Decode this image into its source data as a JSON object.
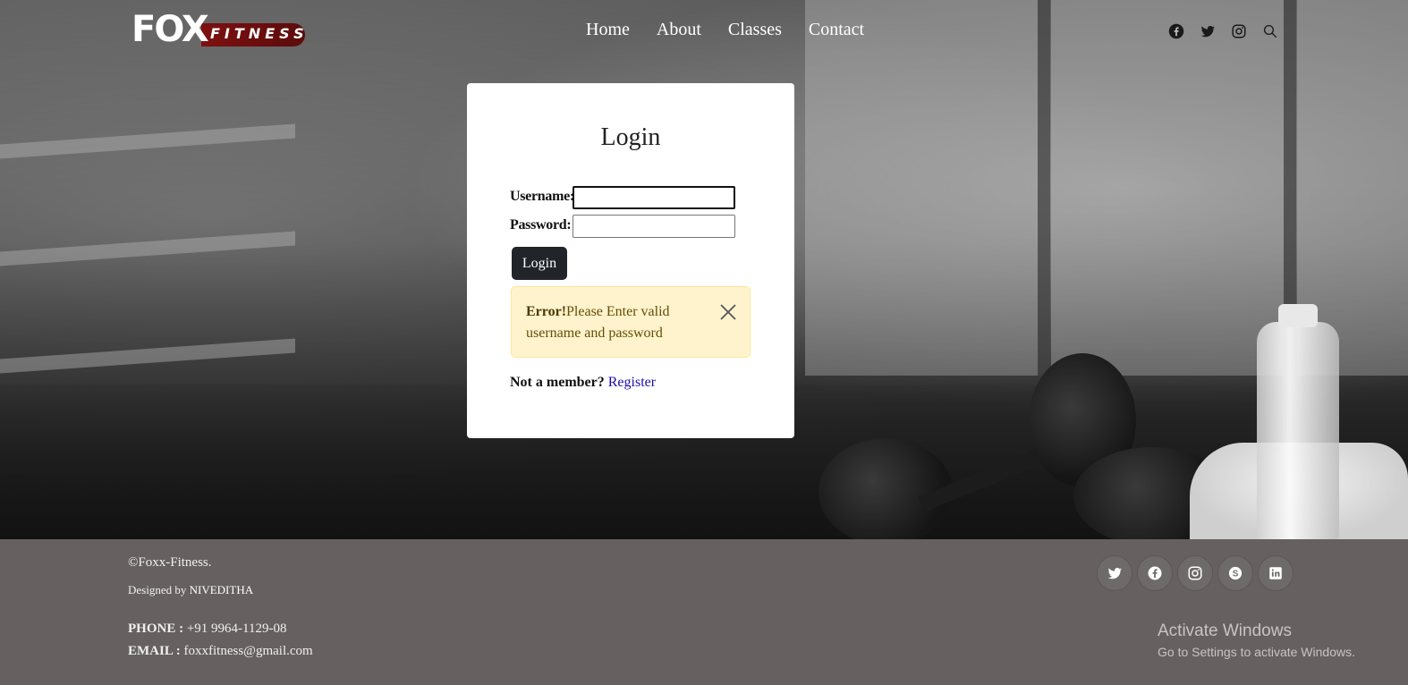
{
  "brand": {
    "logo_main": "FOX",
    "logo_sub": "FITNESS"
  },
  "nav": {
    "items": [
      "Home",
      "About",
      "Classes",
      "Contact"
    ]
  },
  "header_icons": [
    "facebook-icon",
    "twitter-icon",
    "instagram-icon",
    "search-icon"
  ],
  "login": {
    "title": "Login",
    "username_label": "Username:",
    "password_label": "Password:",
    "username_value": "",
    "password_value": "",
    "submit_label": "Login",
    "alert_strong": "Error!",
    "alert_text": "Please Enter valid username and password",
    "member_text": "Not a member?",
    "register_link": "Register"
  },
  "footer": {
    "copyright": "©Foxx-Fitness.",
    "designed_by": "Designed by",
    "designer": "NIVEDITHA",
    "phone_label": "PHONE :",
    "phone": "+91 9964-1129-08",
    "email_label": "EMAIL :",
    "email": "foxxfitness@gmail.com",
    "social_icons": [
      "twitter-icon",
      "facebook-icon",
      "instagram-icon",
      "skype-icon",
      "linkedin-icon"
    ]
  },
  "os_watermark": {
    "title": "Activate Windows",
    "subtitle": "Go to Settings to activate Windows."
  },
  "colors": {
    "alert_bg": "#fff3cd",
    "button_bg": "#212529",
    "footer_bg": "#666060",
    "link": "#1a0dab",
    "logo_red": "#7d1010"
  }
}
